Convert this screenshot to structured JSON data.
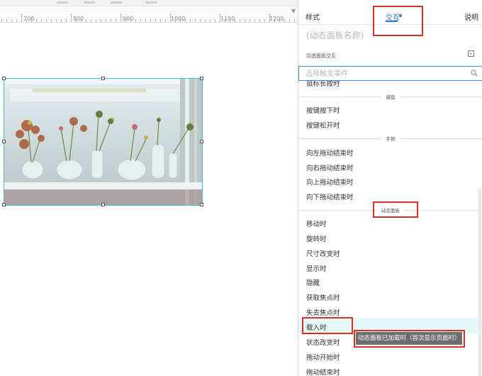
{
  "ruler": {
    "labels": [
      "700",
      "800",
      "900",
      "1000",
      "1100",
      "1200"
    ]
  },
  "canvas": {
    "image_desc_icon": "photo"
  },
  "panel": {
    "tabs": [
      {
        "label": "样式"
      },
      {
        "label": "交互"
      },
      {
        "label": "说明"
      }
    ],
    "active_tab": "交互",
    "widget_name_placeholder": "(动态面板名称)",
    "section_label": "动态面板交互",
    "search_placeholder": "选择触发事件",
    "list": {
      "partial_top": "鼠标长按时",
      "sections": {
        "keyboard": "键盘",
        "gesture": "手势",
        "dynamic_panel": "动态面板"
      },
      "keyboard_items": [
        "按键按下时",
        "按键松开时"
      ],
      "gesture_items": [
        "向左拖动结束时",
        "向右拖动结束时",
        "向上拖动结束时",
        "向下拖动结束时"
      ],
      "panel_items": [
        "移动时",
        "旋转时",
        "尺寸改变时",
        "显示时",
        "隐藏",
        "获取焦点时",
        "失去焦点时",
        "载入时",
        "状态改变时",
        "拖动开始时",
        "拖动结束时"
      ]
    },
    "tooltip": "动态面板已加载时（首次显示页面时）"
  },
  "colors": {
    "accent": "#2e7bd6",
    "annotation_red": "#d93025",
    "selection_cyan": "#40c4d0",
    "hover_row": "#e6f7f7"
  }
}
